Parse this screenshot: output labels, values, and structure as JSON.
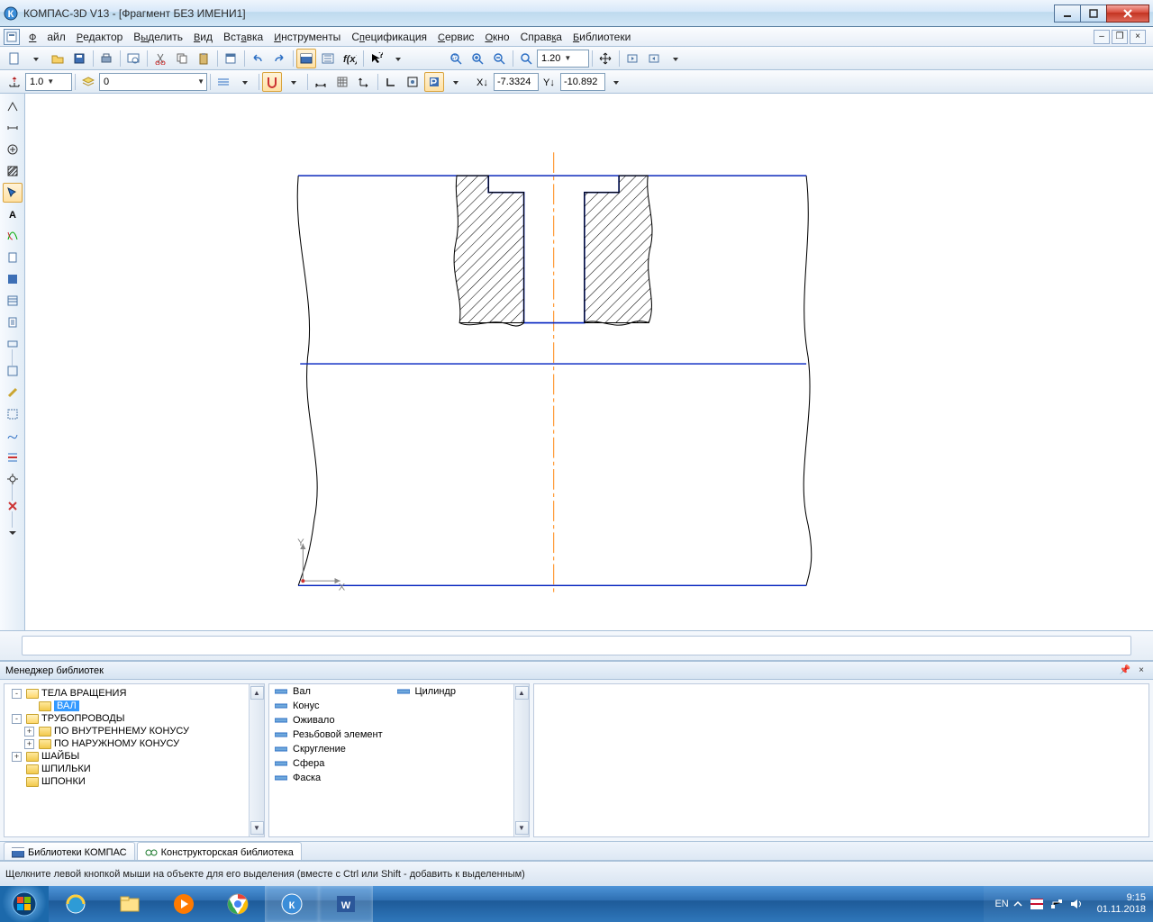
{
  "title": "КОМПАС-3D V13 - [Фрагмент БЕЗ ИМЕНИ1]",
  "menu": {
    "file": "Файл",
    "editor": "Редактор",
    "select": "Выделить",
    "view": "Вид",
    "insert": "Вставка",
    "tools": "Инструменты",
    "spec": "Спецификация",
    "service": "Сервис",
    "window": "Окно",
    "help": "Справка",
    "libs": "Библиотеки"
  },
  "toolbar2": {
    "step": "1.0",
    "layer": "0"
  },
  "zoom": "1.20",
  "readout": {
    "x": "-7.3324",
    "y": "-10.892"
  },
  "lib": {
    "title": "Менеджер библиотек",
    "tree": [
      {
        "t": "ТЕЛА ВРАЩЕНИЯ",
        "exp": true,
        "tog": "-",
        "children": [
          {
            "t": "ВАЛ",
            "sel": true
          }
        ]
      },
      {
        "t": "ТРУБОПРОВОДЫ",
        "exp": true,
        "tog": "-",
        "children": [
          {
            "t": "ПО ВНУТРЕННЕМУ КОНУСУ",
            "tog": "+"
          },
          {
            "t": "ПО НАРУЖНОМУ КОНУСУ",
            "tog": "+"
          }
        ]
      },
      {
        "t": "ШАЙБЫ",
        "tog": "+"
      },
      {
        "t": "ШПИЛЬКИ"
      },
      {
        "t": "ШПОНКИ"
      }
    ],
    "list_left": [
      "Вал",
      "Конус",
      "Оживало",
      "Резьбовой элемент",
      "Скругление",
      "Сфера",
      "Фаска"
    ],
    "list_right": [
      "Цилиндр"
    ],
    "tabs": [
      "Библиотеки КОМПАС",
      "Конструкторская библиотека"
    ]
  },
  "status": "Щелкните левой кнопкой мыши на объекте для его выделения (вместе с Ctrl или Shift - добавить к выделенным)",
  "tray": {
    "lang": "EN",
    "time": "9:15",
    "date": "01.11.2018"
  }
}
